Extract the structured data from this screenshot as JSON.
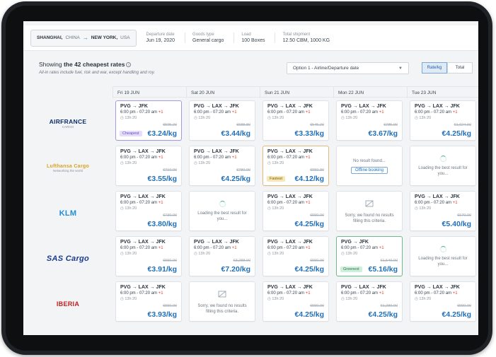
{
  "header": {
    "origin_city": "SHANGHAI,",
    "origin_country": "CHINA",
    "dest_city": "NEW YORK,",
    "dest_country": "USA",
    "departure_label": "Departure date",
    "departure_value": "Jun 19, 2020",
    "goods_label": "Goods type",
    "goods_value": "General cargo",
    "load_label": "Load",
    "load_value": "100 Boxes",
    "shipment_label": "Total shipment",
    "shipment_value": "12.50 CBM, 1000 KG"
  },
  "summary": {
    "prefix": "Showing ",
    "bold": "the 42 cheapest rates",
    "note": "All-in rates include fuel, risk and war, except handling and roy."
  },
  "sort": {
    "value": "Option 1 - Airline/Departure date"
  },
  "toggle": {
    "rate": "Rate/kg",
    "total": "Total"
  },
  "days": [
    "Fri 19 JUN",
    "Sat 20 JUN",
    "Sun 21 JUN",
    "Mon 22 JUN",
    "Tue 23 JUN"
  ],
  "airlines": [
    {
      "name": "AIRFRANCE",
      "sub": "CARGO"
    },
    {
      "name": "Lufthansa Cargo",
      "sub": "Networking the world"
    },
    {
      "name": "KLM",
      "sub": ""
    },
    {
      "name": "SAS Cargo",
      "sub": ""
    },
    {
      "name": "IBERIA",
      "sub": ""
    }
  ],
  "rows": [
    [
      {
        "type": "rate",
        "route": "PVG → JFK",
        "times": "6:00 pm - 07:20 am",
        "plus": "+1",
        "dur": "13h 20",
        "old": "€505.20",
        "price": "€3.24/kg",
        "badge": "Cheapest",
        "badge_type": "cheap"
      },
      {
        "type": "rate",
        "route": "PVG → LAX → JFK",
        "times": "6:00 pm - 07:20 am",
        "plus": "+1",
        "dur": "13h 20",
        "old": "€688.80",
        "price": "€3.44/kg"
      },
      {
        "type": "rate",
        "route": "PVG → LAX → JFK",
        "times": "6:00 pm - 07:20 am",
        "plus": "+1",
        "dur": "13h 20",
        "old": "€545.20",
        "price": "€3.33/kg"
      },
      {
        "type": "rate",
        "route": "PVG → LAX → JFK",
        "times": "6:00 pm - 07:20 am",
        "plus": "+1",
        "dur": "13h 20",
        "old": "€785.00",
        "price": "€3.67/kg"
      },
      {
        "type": "rate",
        "route": "PVG → LAX → JFK",
        "times": "6:00 pm - 07:20 am",
        "plus": "+1",
        "dur": "13h 20",
        "old": "€1,024.90",
        "price": "€4.25/kg"
      }
    ],
    [
      {
        "type": "rate",
        "route": "PVG → LAX → JFK",
        "times": "6:00 pm - 07:20 am",
        "plus": "+1",
        "dur": "13h 20",
        "old": "€710.00",
        "price": "€3.55/kg"
      },
      {
        "type": "rate",
        "route": "PVG → LAX → JFK",
        "times": "6:00 pm - 07:20 am",
        "plus": "+1",
        "dur": "13h 20",
        "old": "€780.00",
        "price": "€4.25/kg"
      },
      {
        "type": "rate",
        "route": "PVG → LAX → JFK",
        "times": "6:00 pm - 07:20 am",
        "plus": "+1",
        "dur": "13h 20",
        "old": "€950.30",
        "price": "€4.12/kg",
        "badge": "Fastest",
        "badge_type": "fast"
      },
      {
        "type": "none",
        "msg": "No result found...",
        "button": "Offline booking"
      },
      {
        "type": "loading",
        "msg": "Loading the best result for you..."
      }
    ],
    [
      {
        "type": "rate",
        "route": "PVG → LAX → JFK",
        "times": "6:00 pm - 07:20 am",
        "plus": "+1",
        "dur": "13h 20",
        "old": "€730.00",
        "price": "€3.80/kg"
      },
      {
        "type": "loading",
        "msg": "Loading the best result for you..."
      },
      {
        "type": "rate",
        "route": "PVG → LAX → JFK",
        "times": "6:00 pm - 07:20 am",
        "plus": "+1",
        "dur": "13h 20",
        "old": "€990.00",
        "price": "€4.25/kg"
      },
      {
        "type": "sorry",
        "msg": "Sorry, we found no results filling this criteria."
      },
      {
        "type": "rate",
        "route": "PVG → LAX → JFK",
        "times": "6:00 pm - 07:20 am",
        "plus": "+1",
        "dur": "13h 20",
        "old": "€670.00",
        "price": "€5.40/kg"
      }
    ],
    [
      {
        "type": "rate",
        "route": "PVG → LAX → JFK",
        "times": "6:00 pm - 07:20 am",
        "plus": "+1",
        "dur": "13h 20",
        "old": "€990.00",
        "price": "€3.91/kg"
      },
      {
        "type": "rate",
        "route": "PVG → LAX → JFK",
        "times": "6:00 pm - 07:20 am",
        "plus": "+1",
        "dur": "13h 20",
        "old": "€3,288.00",
        "price": "€7.20/kg"
      },
      {
        "type": "rate",
        "route": "PVG → LAX → JFK",
        "times": "6:00 pm - 07:20 am",
        "plus": "+1",
        "dur": "13h 20",
        "old": "€990.00",
        "price": "€4.25/kg"
      },
      {
        "type": "rate",
        "route": "PVG → JFK",
        "times": "6:00 pm - 07:20 am",
        "plus": "+1",
        "dur": "13h 20",
        "old": "€1,540.00",
        "price": "€5.16/kg",
        "badge": "Greenest",
        "badge_type": "green"
      },
      {
        "type": "loading",
        "msg": "Loading the best result for you..."
      }
    ],
    [
      {
        "type": "rate",
        "route": "PVG → LAX → JFK",
        "times": "6:00 pm - 07:20 am",
        "plus": "+1",
        "dur": "13h 20",
        "old": "€990.00",
        "price": "€3.93/kg"
      },
      {
        "type": "sorry",
        "msg": "Sorry, we found no results filling this criteria."
      },
      {
        "type": "rate",
        "route": "PVG → LAX → JFK",
        "times": "6:00 pm - 07:20 am",
        "plus": "+1",
        "dur": "13h 20",
        "old": "€990.00",
        "price": "€4.25/kg"
      },
      {
        "type": "rate",
        "route": "PVG → LAX → JFK",
        "times": "6:00 pm - 07:20 am",
        "plus": "+1",
        "dur": "13h 20",
        "old": "€1,280.00",
        "price": "€4.25/kg"
      },
      {
        "type": "rate",
        "route": "PVG → LAX → JFK",
        "times": "6:00 pm - 07:20 am",
        "plus": "+1",
        "dur": "13h 20",
        "old": "€990.00",
        "price": "€4.25/kg"
      }
    ]
  ]
}
